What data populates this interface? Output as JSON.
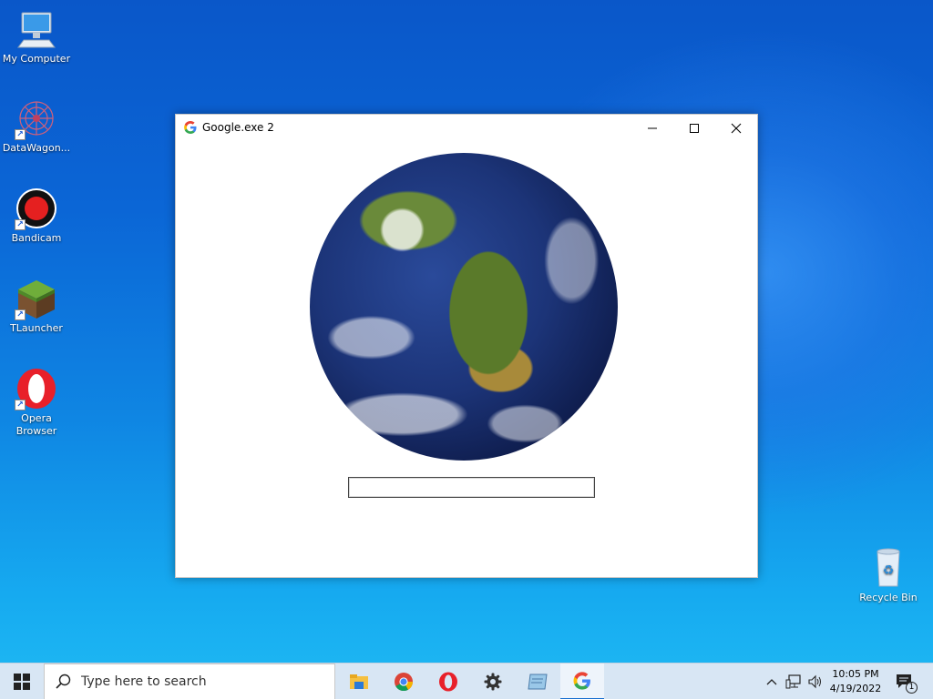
{
  "desktop": {
    "icons": [
      {
        "label": "My Computer",
        "icon": "computer-icon"
      },
      {
        "label": "DataWagon...",
        "icon": "datawagon-icon"
      },
      {
        "label": "Bandicam",
        "icon": "bandicam-icon"
      },
      {
        "label": "TLauncher",
        "icon": "minecraft-block-icon"
      },
      {
        "label": "Opera Browser",
        "icon": "opera-icon"
      },
      {
        "label": "Recycle Bin",
        "icon": "recycle-bin-icon"
      }
    ]
  },
  "window": {
    "title": "Google.exe 2",
    "icon": "google-g-icon",
    "image": "earth-globe",
    "input_value": ""
  },
  "taskbar": {
    "search_placeholder": "Type here to search",
    "apps": [
      "file-explorer-icon",
      "chrome-icon",
      "opera-icon",
      "settings-gear-icon",
      "notepad-icon",
      "google-g-icon"
    ],
    "time": "10:05 PM",
    "date": "4/19/2022",
    "notification_count": "1"
  },
  "colors": {
    "accent": "#1a6fd0",
    "taskbar": "#d8e6f4"
  }
}
